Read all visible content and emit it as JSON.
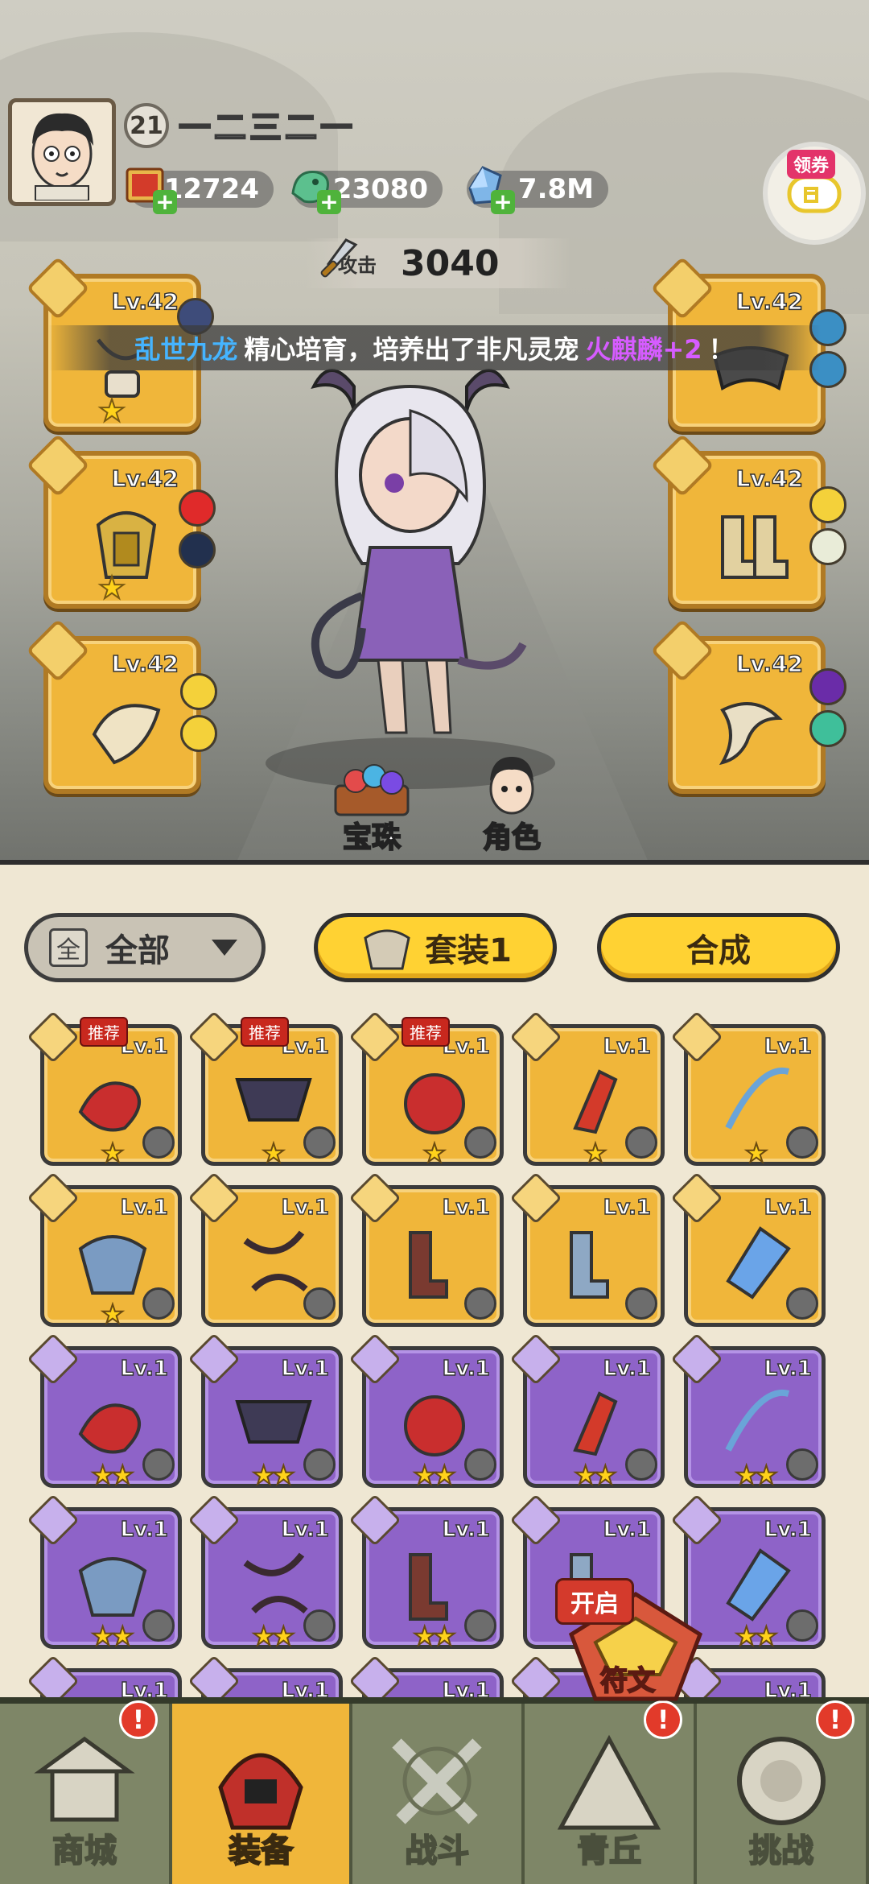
{
  "player": {
    "level": "21",
    "name": "一二三二一"
  },
  "resources": [
    {
      "name": "scroll-currency",
      "value": "12724"
    },
    {
      "name": "jade-dragon-currency",
      "value": "23080"
    },
    {
      "name": "crystal-currency",
      "value": "7.8M"
    }
  ],
  "coupon": {
    "label": "领券"
  },
  "attack": {
    "label": "攻击",
    "value": "3040"
  },
  "broadcast": {
    "player": "乱世九龙",
    "text1": "精心培育，培养出了非凡灵宠",
    "pet": "火麒麟+2",
    "end": "！"
  },
  "equipped": {
    "left": [
      {
        "level": "Lv.42",
        "stars": 1
      },
      {
        "level": "Lv.42",
        "stars": 1
      },
      {
        "level": "Lv.42",
        "stars": 0
      }
    ],
    "right": [
      {
        "level": "Lv.42",
        "stars": 0
      },
      {
        "level": "Lv.42",
        "stars": 0
      },
      {
        "level": "Lv.42",
        "stars": 0
      }
    ]
  },
  "scene_buttons": {
    "orbs": "宝珠",
    "character": "角色"
  },
  "filter": {
    "box": "全",
    "label": "全部"
  },
  "buttons": {
    "set": "套装1",
    "merge": "合成"
  },
  "recommend_label": "推荐",
  "inventory": [
    {
      "tier": "gold",
      "level": "Lv.1",
      "stars": "★",
      "recommend": true
    },
    {
      "tier": "gold",
      "level": "Lv.1",
      "stars": "★",
      "recommend": true
    },
    {
      "tier": "gold",
      "level": "Lv.1",
      "stars": "★",
      "recommend": true
    },
    {
      "tier": "gold",
      "level": "Lv.1",
      "stars": "★",
      "recommend": false
    },
    {
      "tier": "gold",
      "level": "Lv.1",
      "stars": "★",
      "recommend": false
    },
    {
      "tier": "gold",
      "level": "Lv.1",
      "stars": "★",
      "recommend": false
    },
    {
      "tier": "gold",
      "level": "Lv.1",
      "stars": "",
      "recommend": false
    },
    {
      "tier": "gold",
      "level": "Lv.1",
      "stars": "",
      "recommend": false
    },
    {
      "tier": "gold",
      "level": "Lv.1",
      "stars": "",
      "recommend": false
    },
    {
      "tier": "gold",
      "level": "Lv.1",
      "stars": "",
      "recommend": false
    },
    {
      "tier": "purple",
      "level": "Lv.1",
      "stars": "★★",
      "recommend": false
    },
    {
      "tier": "purple",
      "level": "Lv.1",
      "stars": "★★",
      "recommend": false
    },
    {
      "tier": "purple",
      "level": "Lv.1",
      "stars": "★★",
      "recommend": false
    },
    {
      "tier": "purple",
      "level": "Lv.1",
      "stars": "★★",
      "recommend": false
    },
    {
      "tier": "purple",
      "level": "Lv.1",
      "stars": "★★",
      "recommend": false
    },
    {
      "tier": "purple",
      "level": "Lv.1",
      "stars": "★★",
      "recommend": false
    },
    {
      "tier": "purple",
      "level": "Lv.1",
      "stars": "★★",
      "recommend": false
    },
    {
      "tier": "purple",
      "level": "Lv.1",
      "stars": "★★",
      "recommend": false
    },
    {
      "tier": "purple",
      "level": "Lv.1",
      "stars": "",
      "recommend": false
    },
    {
      "tier": "purple",
      "level": "Lv.1",
      "stars": "★★",
      "recommend": false
    },
    {
      "tier": "purple",
      "level": "Lv.1",
      "stars": "",
      "recommend": false
    },
    {
      "tier": "purple",
      "level": "Lv.1",
      "stars": "",
      "recommend": false
    },
    {
      "tier": "purple",
      "level": "Lv.1",
      "stars": "",
      "recommend": false
    },
    {
      "tier": "purple",
      "level": "Lv.1",
      "stars": "",
      "recommend": false
    },
    {
      "tier": "purple",
      "level": "Lv.1",
      "stars": "",
      "recommend": false
    }
  ],
  "rune": {
    "badge": "开启",
    "label": "符文"
  },
  "nav": [
    {
      "label": "商城",
      "icon": "shop-pagoda-icon",
      "alert": "!",
      "active": false
    },
    {
      "label": "装备",
      "icon": "helmet-icon",
      "alert": "",
      "active": true
    },
    {
      "label": "战斗",
      "icon": "crossed-swords-icon",
      "alert": "",
      "active": false
    },
    {
      "label": "青丘",
      "icon": "mountain-icon",
      "alert": "!",
      "active": false
    },
    {
      "label": "挑战",
      "icon": "drum-icon",
      "alert": "!",
      "active": false
    }
  ],
  "colors": {
    "gold_tile": "#f0b63a",
    "purple_tile": "#8e63c8",
    "accent_yellow": "#ffd233",
    "broadcast_name": "#45b4ff",
    "broadcast_pet": "#d65cff",
    "nav_bg": "#7e8667"
  }
}
